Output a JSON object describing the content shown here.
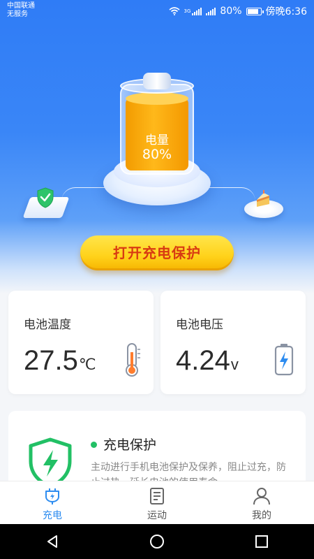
{
  "status_bar": {
    "carrier_line1": "中国联通",
    "carrier_line2": "无服务",
    "network_badge_1": "3G",
    "battery_percent": "80%",
    "time": "傍晚6:36"
  },
  "hero": {
    "battery_label": "电量",
    "battery_value": "80%",
    "protect_button": "打开充电保护"
  },
  "stats": {
    "temperature": {
      "label": "电池温度",
      "value": "27.5",
      "unit": "℃"
    },
    "voltage": {
      "label": "电池电压",
      "value": "4.24",
      "unit": "v"
    }
  },
  "protection_card": {
    "title": "充电保护",
    "description": "主动进行手机电池保护及保养，阻止过充，防止过热，延长电池的使用寿命"
  },
  "tabbar": {
    "items": [
      {
        "label": "充电",
        "icon": "plug-icon",
        "active": true
      },
      {
        "label": "运动",
        "icon": "document-icon",
        "active": false
      },
      {
        "label": "我的",
        "icon": "person-icon",
        "active": false
      }
    ]
  },
  "colors": {
    "hero_blue": "#2f7cf6",
    "button_yellow": "#ffd21a",
    "button_text": "#d83a12",
    "accent_green": "#22c065",
    "tab_active": "#2d8cf0"
  }
}
